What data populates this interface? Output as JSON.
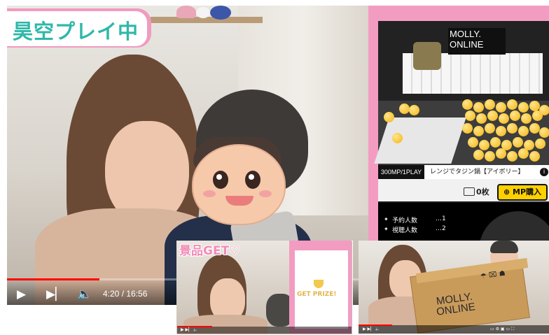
{
  "main_video": {
    "title_badge": "昊空プレイ中",
    "time_current": "4:20",
    "time_total": "16:56",
    "time_display": "4:20 / 16:56",
    "progress": 0.255,
    "icons": [
      "play-icon",
      "skip-next-icon",
      "volume-icon"
    ]
  },
  "game_app": {
    "brand": "MOLLY.\nONLINE",
    "play_cost": "300MP/1PLAY",
    "prize_name": "レンジでタジン鍋【アイボリー】",
    "balance_value": "0",
    "balance_unit": "枚",
    "mp_button": "MP購入",
    "stats": [
      {
        "label": "予約人数",
        "value": "…1"
      },
      {
        "label": "視聴人数",
        "value": "…2"
      }
    ]
  },
  "thumbnail_1": {
    "title": "景品GET♡",
    "prize_text": "GET PRIZE!"
  },
  "thumbnail_2": {
    "box_brand": "MOLLY.\nONLINE"
  },
  "colors": {
    "pink": "#f39cc2",
    "teal": "#2fb8a8",
    "progress_red": "#ff0000",
    "yellow": "#ffd000"
  }
}
